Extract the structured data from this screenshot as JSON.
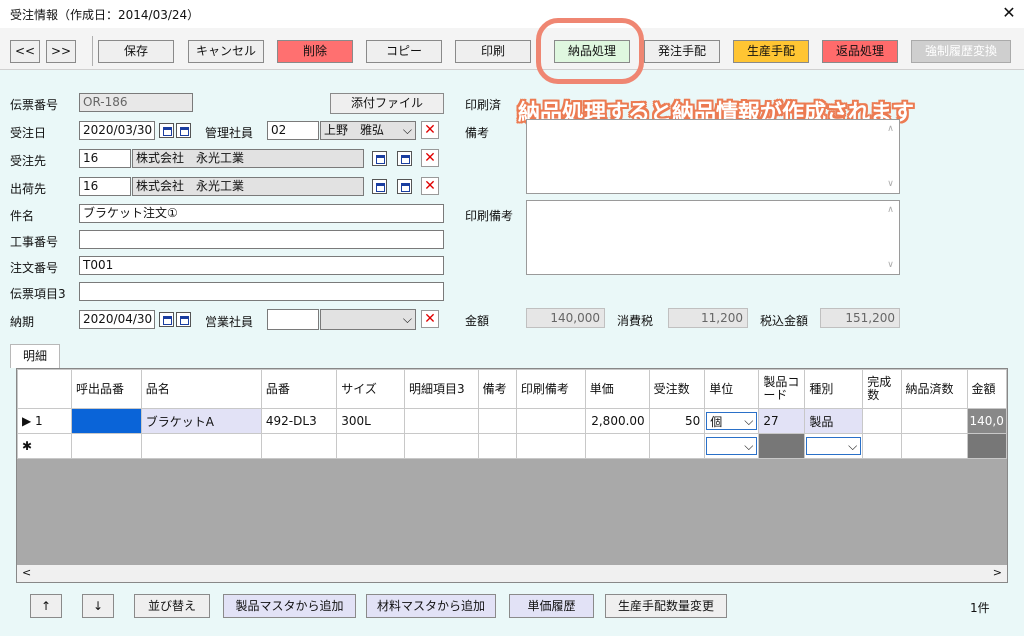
{
  "window": {
    "title": "受注情報（作成日：2014/03/24）",
    "close_glyph": "✕"
  },
  "toolbar": {
    "prev": "<<",
    "next": ">>",
    "save": "保存",
    "cancel": "キャンセル",
    "delete": "削除",
    "copy": "コピー",
    "print": "印刷",
    "delivery": "納品処理",
    "order": "発注手配",
    "production": "生産手配",
    "return": "返品処理",
    "history": "強制履歴変換",
    "colors": {
      "delete": "#ff7070",
      "production": "#ffc533",
      "return": "#ff6b6b",
      "delivery": "#dff7df"
    }
  },
  "form": {
    "slip_no": {
      "label": "伝票番号",
      "value": "OR-186"
    },
    "attach_button": "添付ファイル",
    "print_done": {
      "label": "印刷済"
    },
    "order_date": {
      "label": "受注日",
      "value": "2020/03/30"
    },
    "manager": {
      "label": "管理社員",
      "code": "02",
      "name": "上野　雅弘"
    },
    "note": {
      "label": "備考"
    },
    "customer": {
      "label": "受注先",
      "code": "16",
      "name": "株式会社　永光工業"
    },
    "ship_to": {
      "label": "出荷先",
      "code": "16",
      "name": "株式会社　永光工業"
    },
    "subject": {
      "label": "件名",
      "value": "ブラケット注文①"
    },
    "print_note": {
      "label": "印刷備考"
    },
    "work_no": {
      "label": "工事番号",
      "value": ""
    },
    "order_no": {
      "label": "注文番号",
      "value": "T001"
    },
    "slip_item3": {
      "label": "伝票項目3",
      "value": ""
    },
    "due_date": {
      "label": "納期",
      "value": "2020/04/30"
    },
    "sales_staff": {
      "label": "営業社員",
      "value": ""
    },
    "amount": {
      "label": "金額",
      "value": "140,000"
    },
    "tax": {
      "label": "消費税",
      "value": "11,200"
    },
    "total": {
      "label": "税込金額",
      "value": "151,200"
    }
  },
  "tab": {
    "label": "明細"
  },
  "grid": {
    "headers": [
      "呼出品番",
      "品名",
      "品番",
      "サイズ",
      "明細項目3",
      "備考",
      "印刷備考",
      "単価",
      "受注数",
      "単位",
      "製品コード",
      "種別",
      "完成数",
      "納品済数",
      "金額"
    ],
    "rows": [
      {
        "marker": "▶ 1",
        "call_no": "",
        "name": "ブラケットA",
        "part_no": "492-DL3",
        "size": "300L",
        "item3": "",
        "note": "",
        "print_note": "",
        "unit_price": "2,800.00",
        "qty": "50",
        "unit": "個",
        "product_code": "27",
        "kind": "製品",
        "done": "",
        "delivered": "",
        "amount": "140,0"
      },
      {
        "marker": "✱"
      }
    ]
  },
  "bottom": {
    "up": "↑",
    "down": "↓",
    "sort": "並び替え",
    "add_product": "製品マスタから追加",
    "add_material": "材料マスタから追加",
    "price_history": "単価履歴",
    "production_qty": "生産手配数量変更",
    "count": "1件"
  },
  "annotation": {
    "text": "納品処理すると納品情報が作成されます",
    "color": "#ef8672"
  }
}
